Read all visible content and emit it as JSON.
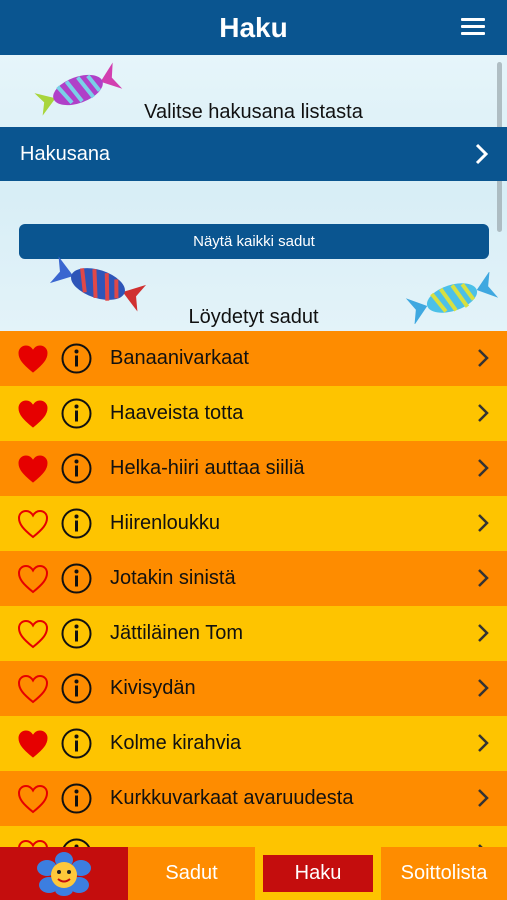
{
  "header": {
    "title": "Haku",
    "menu_icon": "hamburger-menu-icon"
  },
  "search": {
    "prompt": "Valitse hakusana listasta",
    "label": "Hakusana"
  },
  "show_all_label": "Näytä kaikki sadut",
  "found_title": "Löydetyt sadut",
  "colors": {
    "blue": "#0a5590",
    "orange": "#fe8c00",
    "yellow": "#fec400",
    "red": "#c40d0d",
    "heart": "#e60000"
  },
  "stories": [
    {
      "name": "Banaanivarkaat",
      "favorite": true
    },
    {
      "name": "Haaveista totta",
      "favorite": true
    },
    {
      "name": "Helka-hiiri auttaa siiliä",
      "favorite": true
    },
    {
      "name": "Hiirenloukku",
      "favorite": false
    },
    {
      "name": "Jotakin sinistä",
      "favorite": false
    },
    {
      "name": "Jättiläinen Tom",
      "favorite": false
    },
    {
      "name": "Kivisydän",
      "favorite": false
    },
    {
      "name": "Kolme kirahvia",
      "favorite": true
    },
    {
      "name": "Kurkkuvarkaat avaruudesta",
      "favorite": false
    },
    {
      "name": "",
      "favorite": false
    }
  ],
  "tabs": {
    "sadut": "Sadut",
    "haku": "Haku",
    "soittolista": "Soittolista"
  }
}
